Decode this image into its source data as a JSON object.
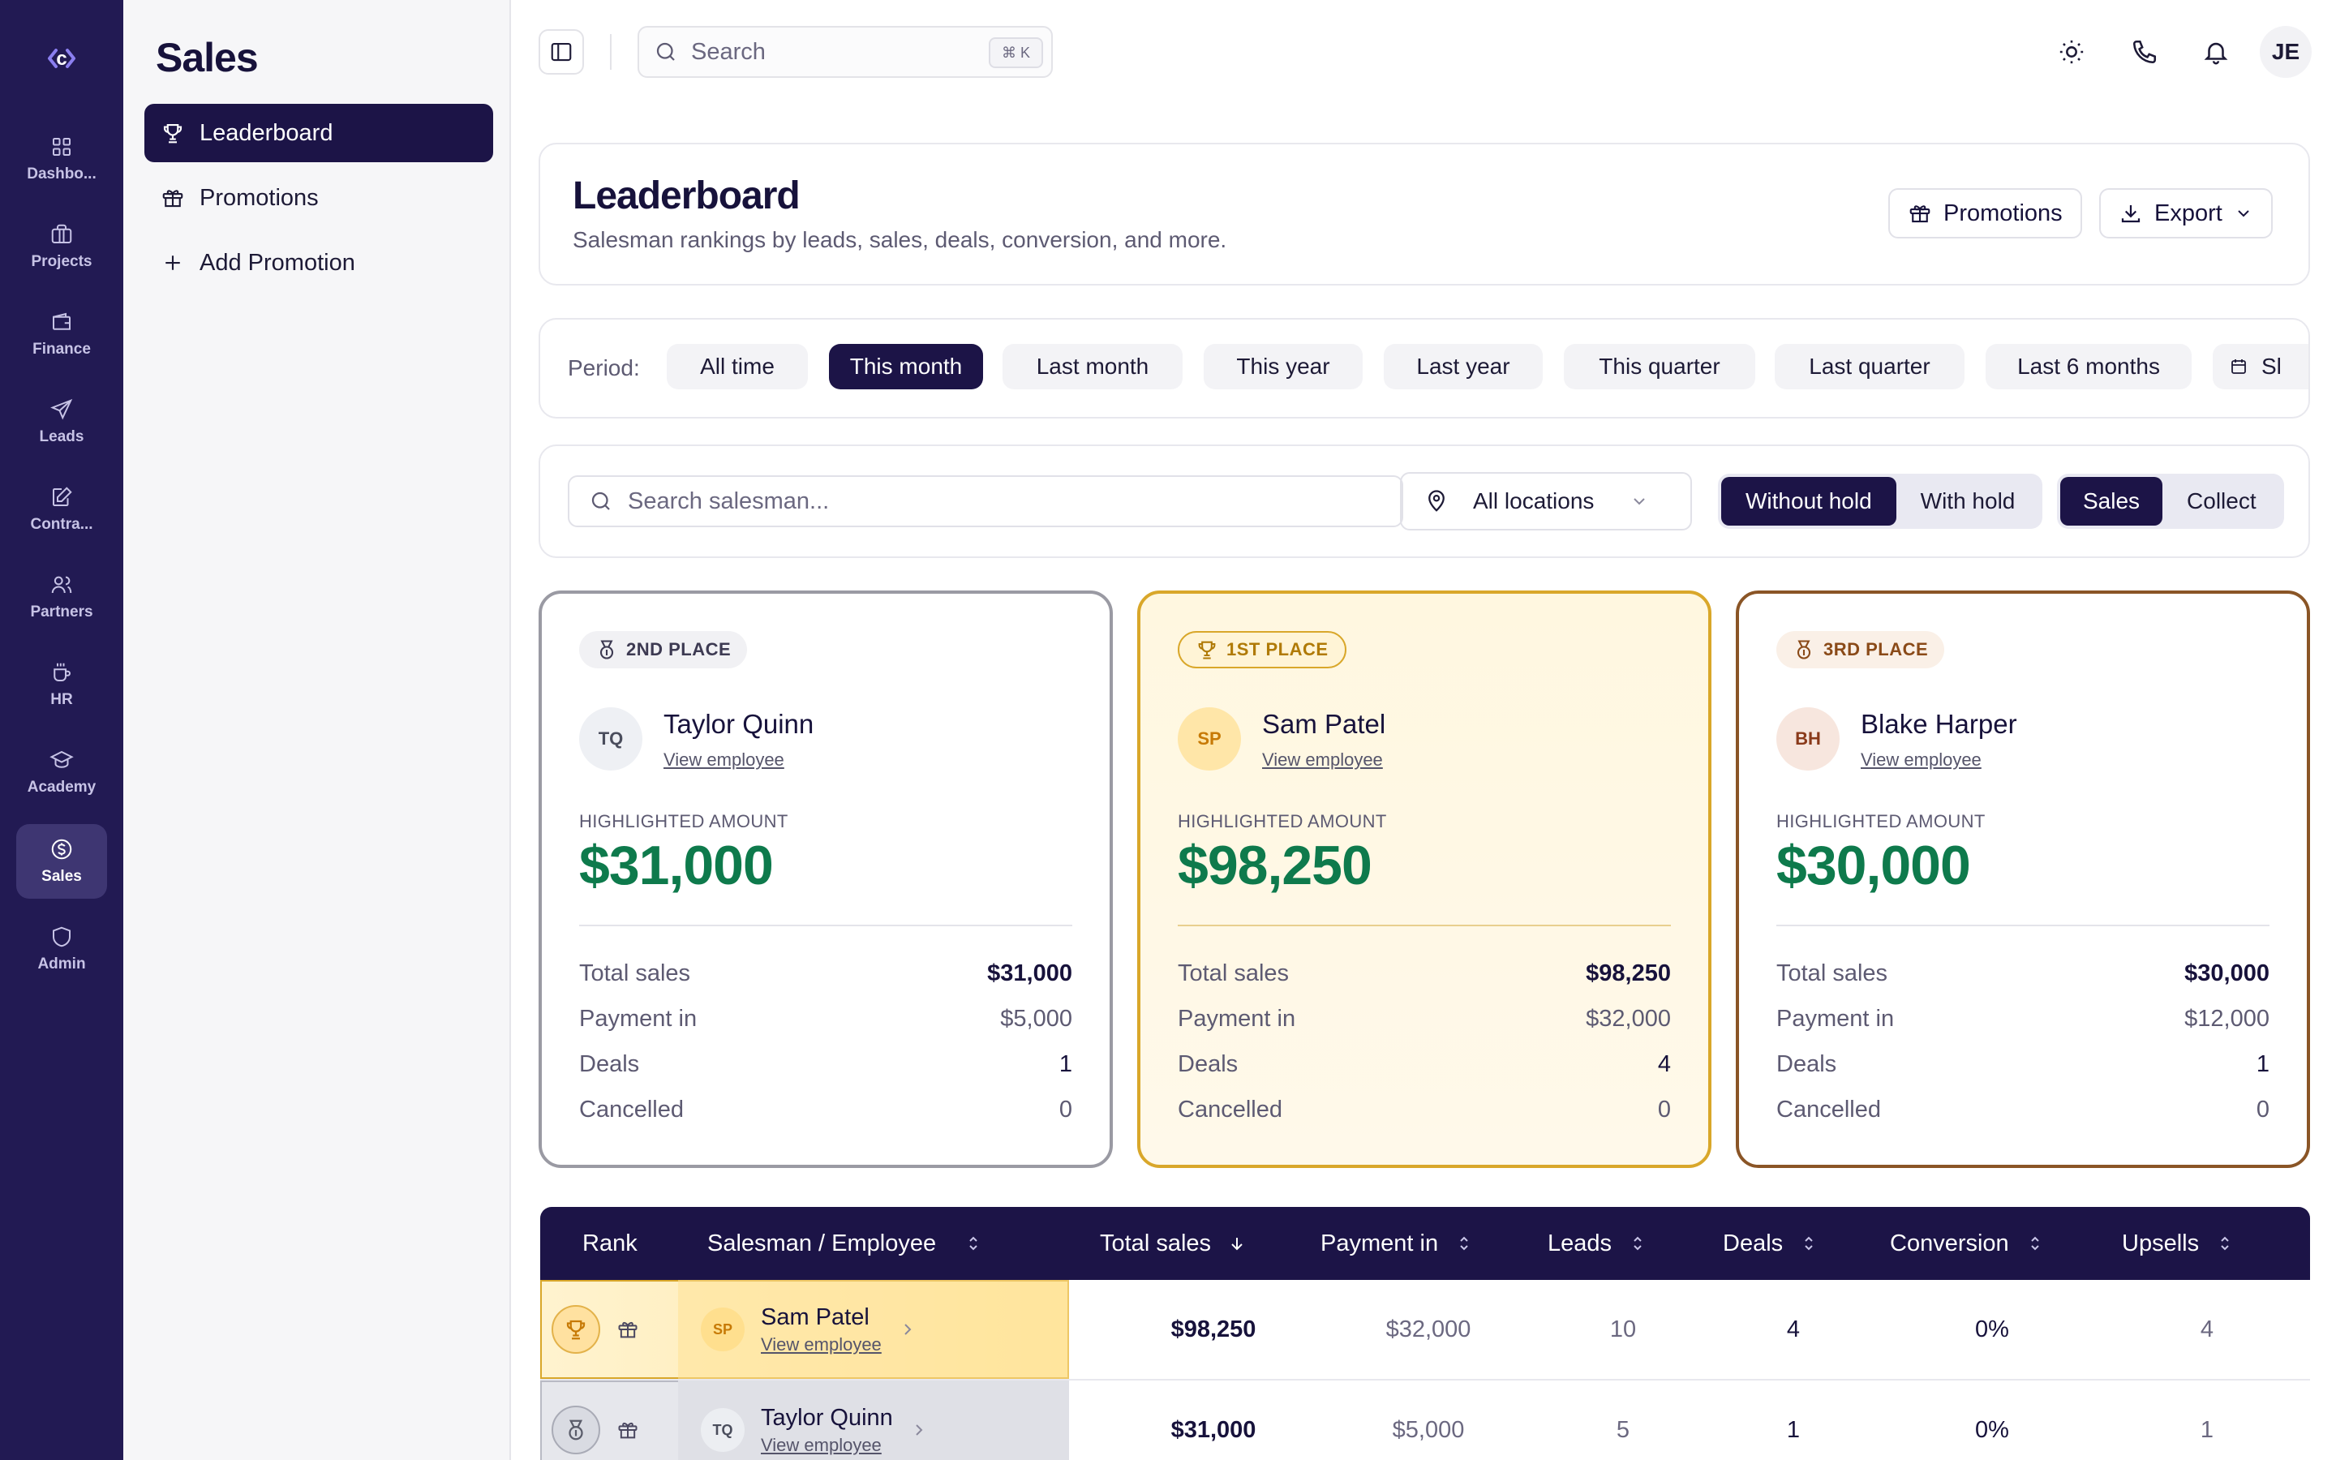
{
  "rail": {
    "logo": "c",
    "items": [
      {
        "label": "Dashbo...",
        "icon": "dashboard-icon"
      },
      {
        "label": "Projects",
        "icon": "briefcase-icon"
      },
      {
        "label": "Finance",
        "icon": "wallet-icon"
      },
      {
        "label": "Leads",
        "icon": "send-icon"
      },
      {
        "label": "Contra...",
        "icon": "contract-icon"
      },
      {
        "label": "Partners",
        "icon": "users-icon"
      },
      {
        "label": "HR",
        "icon": "coffee-icon"
      },
      {
        "label": "Academy",
        "icon": "graduation-cap-icon"
      },
      {
        "label": "Sales",
        "icon": "dollar-icon",
        "active": true
      },
      {
        "label": "Admin",
        "icon": "shield-icon"
      }
    ]
  },
  "subbar": {
    "title": "Sales",
    "items": [
      {
        "label": "Leaderboard",
        "icon": "trophy-icon",
        "active": true
      },
      {
        "label": "Promotions",
        "icon": "gift-icon"
      },
      {
        "label": "Add Promotion",
        "icon": "plus-icon"
      }
    ]
  },
  "topbar": {
    "search_placeholder": "Search",
    "shortcut": "⌘ K",
    "avatar_initials": "JE"
  },
  "header": {
    "title": "Leaderboard",
    "subtitle": "Salesman rankings by leads, sales, deals, conversion, and more.",
    "promotions_button": "Promotions",
    "export_button": "Export"
  },
  "period": {
    "label": "Period:",
    "options": [
      "All time",
      "This month",
      "Last month",
      "This year",
      "Last year",
      "This quarter",
      "Last quarter",
      "Last 6 months",
      "Sl"
    ],
    "selected": "This month"
  },
  "filters": {
    "search_placeholder": "Search salesman...",
    "location": "All locations",
    "hold_options": [
      "Without hold",
      "With hold"
    ],
    "hold_selected": "Without hold",
    "mode_options": [
      "Sales",
      "Collect"
    ],
    "mode_selected": "Sales"
  },
  "podium": {
    "highlight_label": "HIGHLIGHTED AMOUNT",
    "view_link": "View employee",
    "row_labels": [
      "Total sales",
      "Payment in",
      "Deals",
      "Cancelled"
    ],
    "cards": [
      {
        "place": "2ND PLACE",
        "initials": "TQ",
        "name": "Taylor Quinn",
        "amount": "$31,000",
        "total_sales": "$31,000",
        "payment_in": "$5,000",
        "deals": "1",
        "cancelled": "0"
      },
      {
        "place": "1ST PLACE",
        "initials": "SP",
        "name": "Sam Patel",
        "amount": "$98,250",
        "total_sales": "$98,250",
        "payment_in": "$32,000",
        "deals": "4",
        "cancelled": "0"
      },
      {
        "place": "3RD PLACE",
        "initials": "BH",
        "name": "Blake Harper",
        "amount": "$30,000",
        "total_sales": "$30,000",
        "payment_in": "$12,000",
        "deals": "1",
        "cancelled": "0"
      }
    ]
  },
  "table": {
    "columns": [
      "Rank",
      "Salesman / Employee",
      "Total sales",
      "Payment in",
      "Leads",
      "Deals",
      "Conversion",
      "Upsells"
    ],
    "rows": [
      {
        "initials": "SP",
        "name": "Sam Patel",
        "link": "View employee",
        "total_sales": "$98,250",
        "payment_in": "$32,000",
        "leads": "10",
        "deals": "4",
        "conversion": "0%",
        "upsells": "4"
      },
      {
        "initials": "TQ",
        "name": "Taylor Quinn",
        "link": "View employee",
        "total_sales": "$31,000",
        "payment_in": "$5,000",
        "leads": "5",
        "deals": "1",
        "conversion": "0%",
        "upsells": "1"
      }
    ]
  },
  "colors": {
    "brand": "#1c1447",
    "rail": "#221a53",
    "gold": "#d9a72a",
    "silver": "#9a9aa3",
    "bronze": "#8a5526",
    "money": "#0e7a4c"
  }
}
